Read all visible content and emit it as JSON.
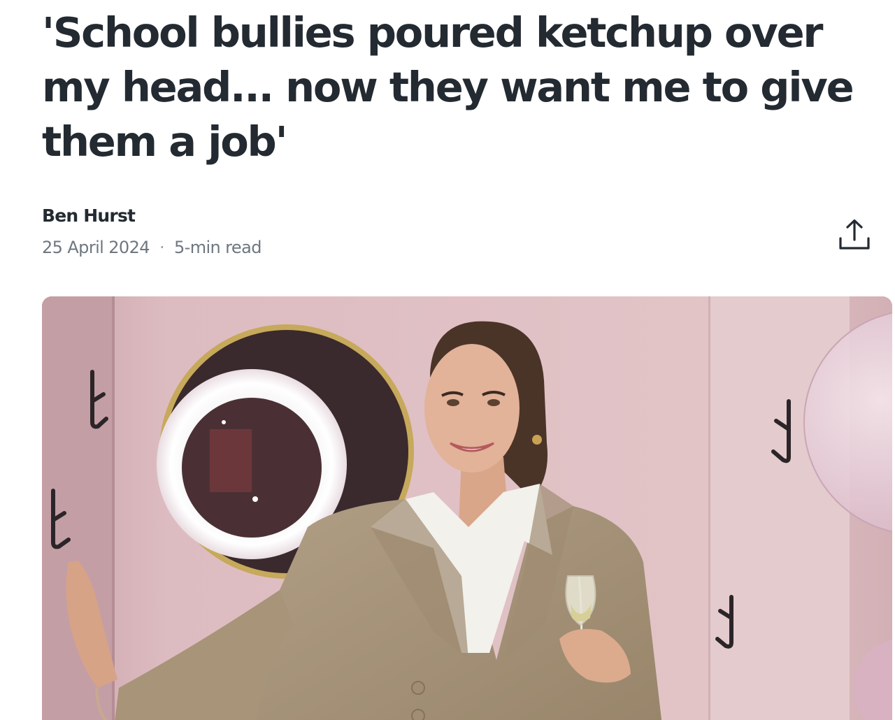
{
  "article": {
    "headline": "'School bullies poured ketchup over my head... now they want me to give them a job'",
    "author": "Ben Hurst",
    "date": "25 April 2024",
    "separator": "·",
    "read_time": "5-min read"
  },
  "share": {
    "icon": "share-icon"
  },
  "hero_image": {
    "subject": "woman-in-beige-blazer-holding-champagne-glass"
  },
  "colors": {
    "text": "#232a31",
    "meta": "#6e7780",
    "wall": "#d9b8bd",
    "blazer": "#a8957c"
  }
}
